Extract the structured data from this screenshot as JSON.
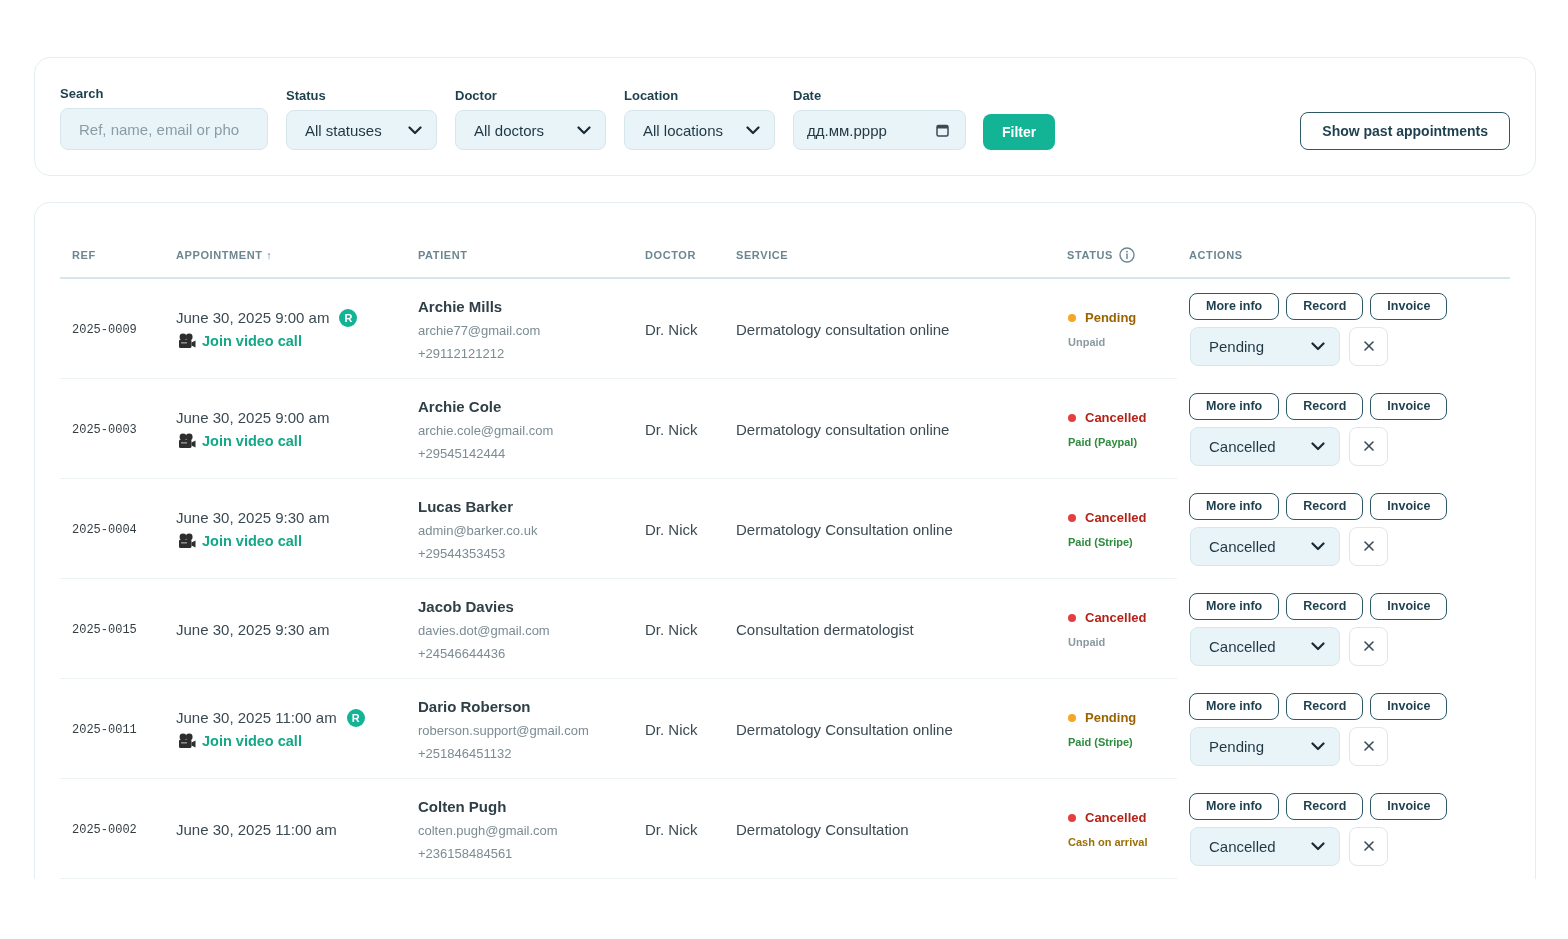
{
  "filters": {
    "fields": [
      {
        "kind": "text",
        "label": "Search",
        "placeholder": "Ref, name, email or pho"
      },
      {
        "kind": "select",
        "label": "Status",
        "value": "All statuses"
      },
      {
        "kind": "select",
        "label": "Doctor",
        "value": "All doctors"
      },
      {
        "kind": "select",
        "label": "Location",
        "value": "All locations"
      },
      {
        "kind": "date",
        "label": "Date",
        "placeholder": "дд.мм.рррр"
      }
    ],
    "filter_button": "Filter",
    "past_button": "Show past appointments"
  },
  "table": {
    "columns": [
      {
        "label": "REF"
      },
      {
        "label": "APPOINTMENT",
        "sort": "↑"
      },
      {
        "label": "PATIENT"
      },
      {
        "label": "DOCTOR"
      },
      {
        "label": "SERVICE"
      },
      {
        "label": "STATUS",
        "info": true
      },
      {
        "label": "ACTIONS"
      }
    ],
    "rows": [
      {
        "ref": "2025-0009",
        "date": "June 30, 2025 9:00 am",
        "badge": "R",
        "video_link": "Join video call",
        "patient": {
          "name": "Archie Mills",
          "email": "archie77@gmail.com",
          "phone": "+29112121212"
        },
        "doctor": "Dr. Nick",
        "service": "Dermatology consultation online",
        "status": {
          "kind": "pending",
          "label": "Pending",
          "color": "#f5a623"
        },
        "payment": {
          "kind": "unpaid",
          "label": "Unpaid"
        },
        "actions": [
          "More info",
          "Record",
          "Invoice"
        ],
        "status_select": "Pending"
      },
      {
        "ref": "2025-0003",
        "date": "June 30, 2025 9:00 am",
        "video_link": "Join video call",
        "patient": {
          "name": "Archie Cole",
          "email": "archie.cole@gmail.com",
          "phone": "+29545142444"
        },
        "doctor": "Dr. Nick",
        "service": "Dermatology consultation online",
        "status": {
          "kind": "cancelled",
          "label": "Cancelled",
          "color": "#e53e3e"
        },
        "payment": {
          "kind": "paid",
          "label": "Paid (Paypal)"
        },
        "actions": [
          "More info",
          "Record",
          "Invoice"
        ],
        "status_select": "Cancelled"
      },
      {
        "ref": "2025-0004",
        "date": "June 30, 2025 9:30 am",
        "video_link": "Join video call",
        "patient": {
          "name": "Lucas Barker",
          "email": "admin@barker.co.uk",
          "phone": "+29544353453"
        },
        "doctor": "Dr. Nick",
        "service": "Dermatology Consultation online",
        "status": {
          "kind": "cancelled",
          "label": "Cancelled",
          "color": "#e53e3e"
        },
        "payment": {
          "kind": "paid",
          "label": "Paid (Stripe)"
        },
        "actions": [
          "More info",
          "Record",
          "Invoice"
        ],
        "status_select": "Cancelled"
      },
      {
        "ref": "2025-0015",
        "date": "June 30, 2025 9:30 am",
        "patient": {
          "name": "Jacob Davies",
          "email": "davies.dot@gmail.com",
          "phone": "+24546644436"
        },
        "doctor": "Dr. Nick",
        "service": "Consultation dermatologist",
        "status": {
          "kind": "cancelled",
          "label": "Cancelled",
          "color": "#e53e3e"
        },
        "payment": {
          "kind": "unpaid",
          "label": "Unpaid"
        },
        "actions": [
          "More info",
          "Record",
          "Invoice"
        ],
        "status_select": "Cancelled"
      },
      {
        "ref": "2025-0011",
        "date": "June 30, 2025 11:00 am",
        "badge": "R",
        "video_link": "Join video call",
        "patient": {
          "name": "Dario Roberson",
          "email": "roberson.support@gmail.com",
          "phone": "+251846451132"
        },
        "doctor": "Dr. Nick",
        "service": "Dermatology Consultation online",
        "status": {
          "kind": "pending",
          "label": "Pending",
          "color": "#f5a623"
        },
        "payment": {
          "kind": "paid",
          "label": "Paid (Stripe)"
        },
        "actions": [
          "More info",
          "Record",
          "Invoice"
        ],
        "status_select": "Pending"
      },
      {
        "ref": "2025-0002",
        "date": "June 30, 2025 11:00 am",
        "patient": {
          "name": "Colten Pugh",
          "email": "colten.pugh@gmail.com",
          "phone": "+236158484561"
        },
        "doctor": "Dr. Nick",
        "service": "Dermatology Consultation",
        "status": {
          "kind": "cancelled",
          "label": "Cancelled",
          "color": "#e53e3e"
        },
        "payment": {
          "kind": "cash",
          "label": "Cash on arrival"
        },
        "actions": [
          "More info",
          "Record",
          "Invoice"
        ],
        "status_select": "Cancelled"
      }
    ]
  }
}
